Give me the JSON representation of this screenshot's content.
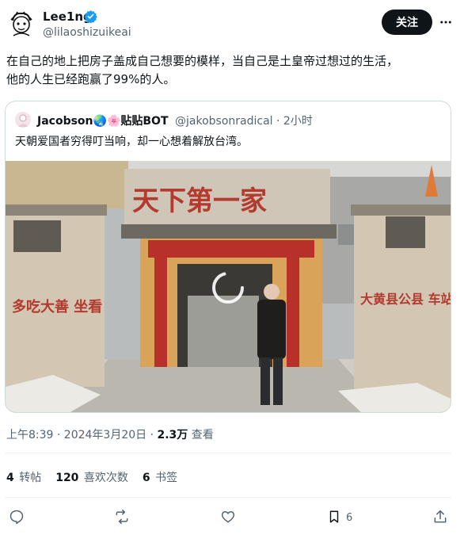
{
  "author": {
    "display_name": "Lee1ng",
    "handle": "@lilaoshizuikeai",
    "follow_label": "关注"
  },
  "tweet": {
    "line1": "在自己的地上把房子盖成自己想要的模样，当自己是土皇帝过想过的生活，",
    "line2": "他的人生已经跑赢了99%的人。"
  },
  "quoted": {
    "display_name": "Jacobson🌏🌸贴贴BOT",
    "handle_time": "@jakobsonradical · 2小时",
    "text": "天朝爱国者穷得叮当响，却一心想着解放台湾。",
    "media_sign_top": "天下第一家",
    "media_wall_left": "多吃大善 坐看",
    "media_wall_right": "大黄县公县 车站"
  },
  "meta": {
    "time": "上午8:39 · 2024年3月20日 · ",
    "views_count": "2.3万",
    "views_label": " 查看"
  },
  "stats": {
    "retweets_count": "4",
    "retweets_label": "转帖",
    "likes_count": "120",
    "likes_label": "喜欢次数",
    "bookmarks_count": "6",
    "bookmarks_label": "书签"
  },
  "actions": {
    "bookmark_count": "6",
    "icons": [
      "reply-icon",
      "retweet-icon",
      "like-icon",
      "bookmark-icon",
      "share-icon"
    ]
  },
  "colors": {
    "text": "#0f1419",
    "secondary": "#536471",
    "border": "#cfd9de",
    "verified": "#1d9bf0"
  }
}
